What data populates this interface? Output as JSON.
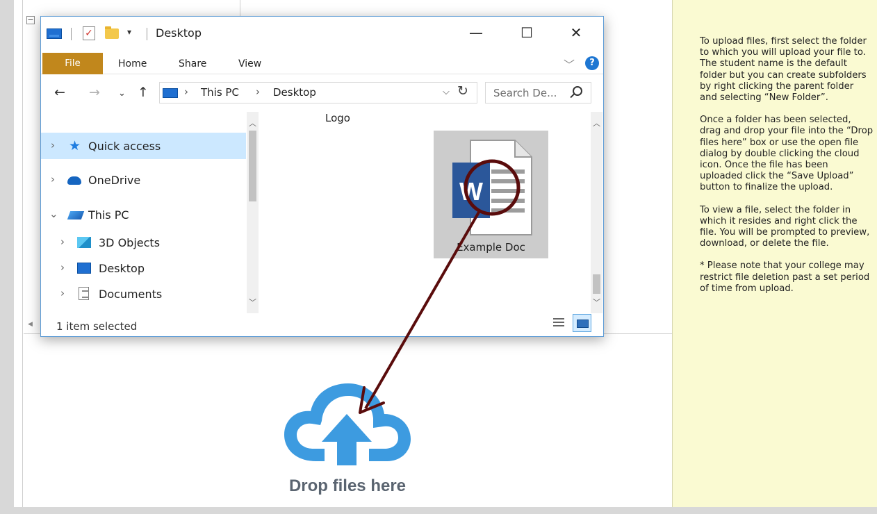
{
  "window": {
    "title": "Desktop",
    "dropdown_glyph": "▾",
    "min_glyph": "—",
    "max_glyph": "☐",
    "close_glyph": "✕"
  },
  "ribbon": {
    "file": "File",
    "tabs": [
      "Home",
      "Share",
      "View"
    ],
    "help": "?"
  },
  "address": {
    "crumbs": [
      "This PC",
      "Desktop"
    ],
    "search_placeholder": "Search De..."
  },
  "nav_pane": {
    "items": [
      {
        "label": "Quick access",
        "icon": "star-icon",
        "selected": true
      },
      {
        "label": "OneDrive",
        "icon": "cloud-icon"
      },
      {
        "label": "This PC",
        "icon": "computer-icon",
        "expanded": true
      },
      {
        "label": "3D Objects",
        "icon": "cube-icon"
      },
      {
        "label": "Desktop",
        "icon": "desktop-icon"
      },
      {
        "label": "Documents",
        "icon": "documents-icon"
      }
    ]
  },
  "content": {
    "logo_label": "Logo",
    "file_name": "Example Doc",
    "word_letter": "W"
  },
  "status": {
    "text": "1 item selected"
  },
  "help_panel": {
    "paragraphs": [
      "To upload files, first select the folder to which you will upload your file to. The student name is the default folder but you can create subfolders by right clicking the parent folder and selecting “New Folder”.",
      "Once a folder has been selected, drag and drop your file into the “Drop files here” box or use the open file dialog by double clicking the cloud icon. Once the file has been uploaded click the “Save Upload” button to finalize the upload.",
      "To view a file, select the folder in which it resides and right click the file. You will be prompted to preview, download, or delete the file.",
      "* Please note that your college may restrict file deletion past a set period of time from upload."
    ]
  },
  "drop_zone": {
    "label": "Drop files here"
  },
  "colors": {
    "cloud": "#3d9be0",
    "annotation": "#5a0c0c",
    "help_bg": "#fafad2",
    "file_tab": "#c1871c"
  }
}
